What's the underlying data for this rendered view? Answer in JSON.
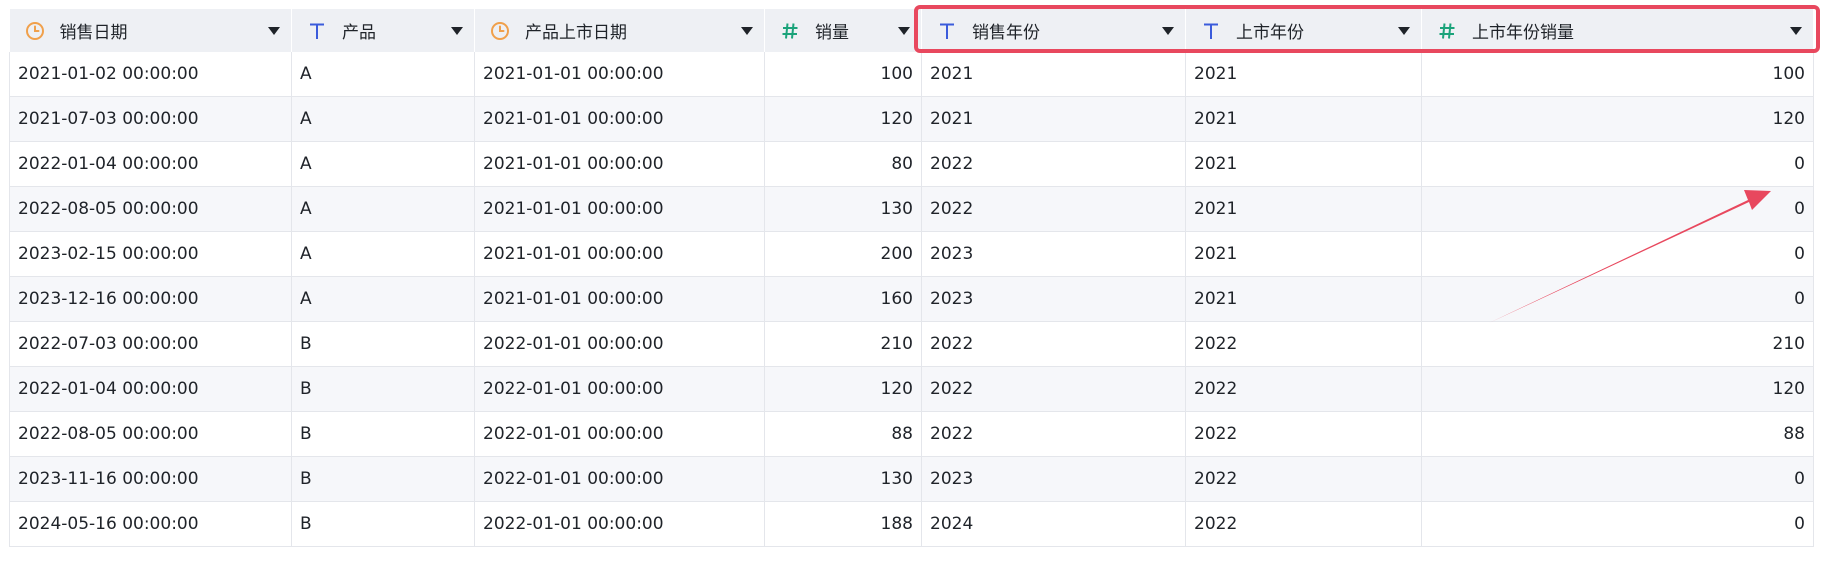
{
  "columns": [
    {
      "label": "销售日期",
      "type_icon": "clock-icon",
      "align": "left"
    },
    {
      "label": "产品",
      "type_icon": "text-type-icon",
      "align": "left"
    },
    {
      "label": "产品上市日期",
      "type_icon": "clock-icon",
      "align": "left"
    },
    {
      "label": "销量",
      "type_icon": "hash-icon",
      "align": "right"
    },
    {
      "label": "销售年份",
      "type_icon": "text-type-icon",
      "align": "left"
    },
    {
      "label": "上市年份",
      "type_icon": "text-type-icon",
      "align": "left"
    },
    {
      "label": "上市年份销量",
      "type_icon": "hash-icon",
      "align": "right"
    }
  ],
  "rows": [
    [
      "2021-01-02 00:00:00",
      "A",
      "2021-01-01 00:00:00",
      "100",
      "2021",
      "2021",
      "100"
    ],
    [
      "2021-07-03 00:00:00",
      "A",
      "2021-01-01 00:00:00",
      "120",
      "2021",
      "2021",
      "120"
    ],
    [
      "2022-01-04 00:00:00",
      "A",
      "2021-01-01 00:00:00",
      "80",
      "2022",
      "2021",
      "0"
    ],
    [
      "2022-08-05 00:00:00",
      "A",
      "2021-01-01 00:00:00",
      "130",
      "2022",
      "2021",
      "0"
    ],
    [
      "2023-02-15 00:00:00",
      "A",
      "2021-01-01 00:00:00",
      "200",
      "2023",
      "2021",
      "0"
    ],
    [
      "2023-12-16 00:00:00",
      "A",
      "2021-01-01 00:00:00",
      "160",
      "2023",
      "2021",
      "0"
    ],
    [
      "2022-07-03 00:00:00",
      "B",
      "2022-01-01 00:00:00",
      "210",
      "2022",
      "2022",
      "210"
    ],
    [
      "2022-01-04 00:00:00",
      "B",
      "2022-01-01 00:00:00",
      "120",
      "2022",
      "2022",
      "120"
    ],
    [
      "2022-08-05 00:00:00",
      "B",
      "2022-01-01 00:00:00",
      "88",
      "2022",
      "2022",
      "88"
    ],
    [
      "2023-11-16 00:00:00",
      "B",
      "2022-01-01 00:00:00",
      "130",
      "2023",
      "2022",
      "0"
    ],
    [
      "2024-05-16 00:00:00",
      "B",
      "2022-01-01 00:00:00",
      "188",
      "2024",
      "2022",
      "0"
    ]
  ],
  "colors": {
    "annotation": "#e8485e",
    "clock_icon": "#f0a04b",
    "text_icon": "#3b5bdb",
    "hash_icon": "#1aa37a",
    "header_bg": "#eef0f4"
  }
}
